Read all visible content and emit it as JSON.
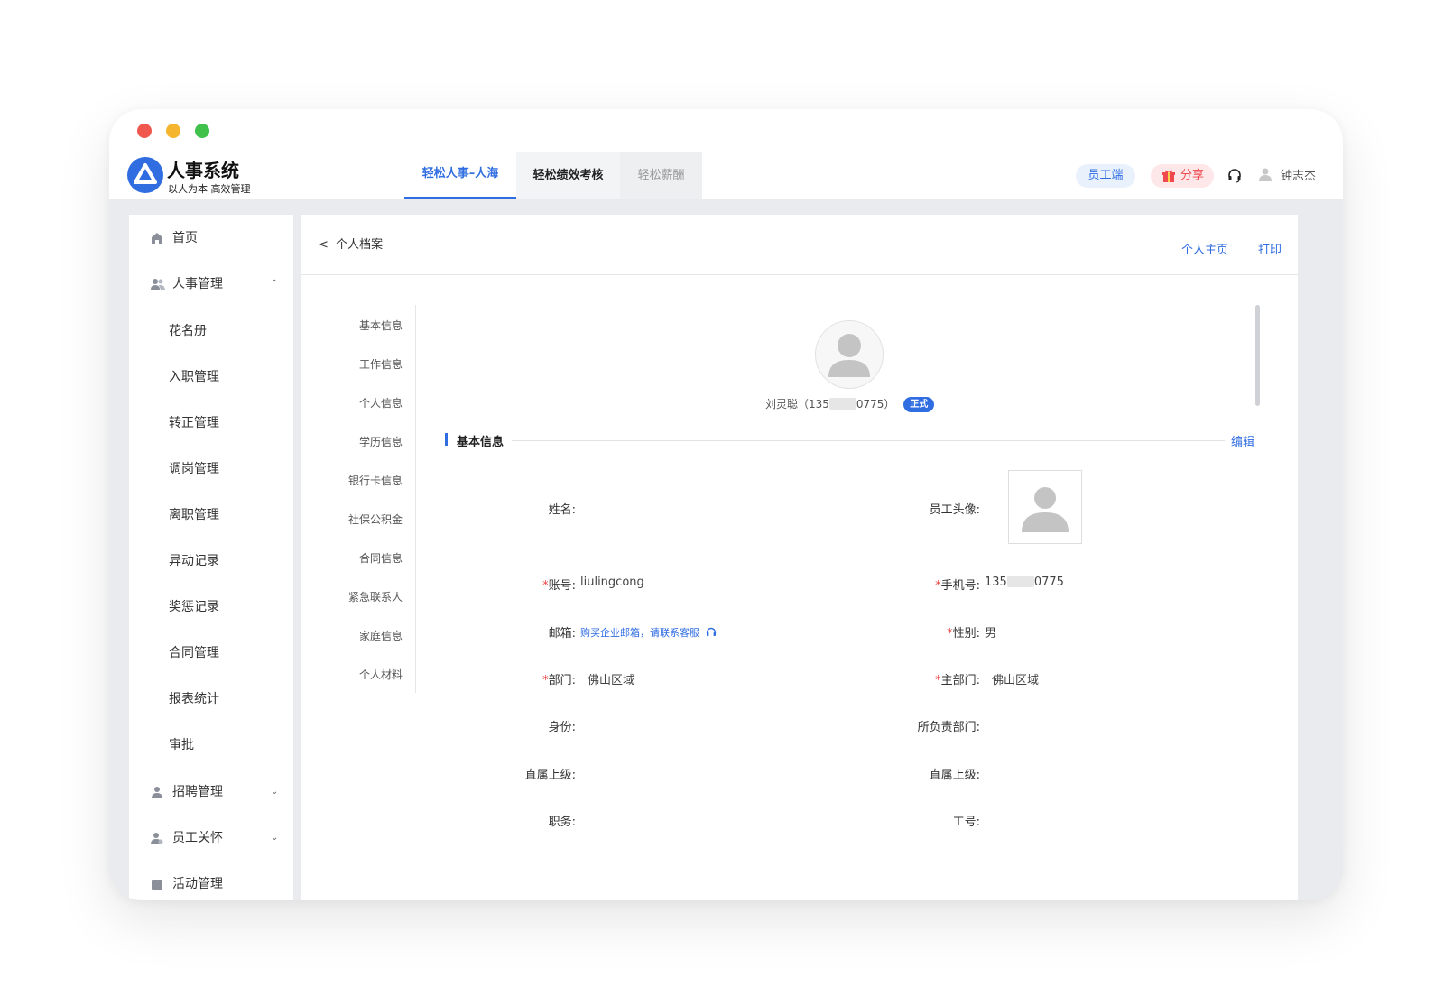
{
  "app": {
    "title": "人事系统",
    "subtitle": "以人为本 高效管理"
  },
  "tabs": [
    {
      "label": "轻松人事–人海",
      "state": "active"
    },
    {
      "label": "轻松绩效考核",
      "state": "normal"
    },
    {
      "label": "轻松薪酬",
      "state": "disabled"
    }
  ],
  "header": {
    "employee_button": "员工端",
    "share_button": "分享",
    "username": "钟志杰"
  },
  "sidebar": {
    "home": "首页",
    "hr_management": "人事管理",
    "hr_sub_items": [
      "花名册",
      "入职管理",
      "转正管理",
      "调岗管理",
      "离职管理",
      "异动记录",
      "奖惩记录",
      "合同管理",
      "报表统计",
      "审批"
    ],
    "recruitment": "招聘管理",
    "employee_care": "员工关怀",
    "activity": "活动管理"
  },
  "page": {
    "back_label": "个人档案",
    "home_link": "个人主页",
    "print_link": "打印"
  },
  "anchors": [
    "基本信息",
    "工作信息",
    "个人信息",
    "学历信息",
    "银行卡信息",
    "社保公积金",
    "合同信息",
    "紧急联系人",
    "家庭信息",
    "个人材料"
  ],
  "profile": {
    "name_phone_prefix": "刘灵聪（135",
    "name_phone_suffix": "0775）",
    "status_badge": "正式"
  },
  "section": {
    "title": "基本信息",
    "edit_label": "编辑"
  },
  "fields": {
    "name_label": "姓名:",
    "photo_label": "员工头像:",
    "account_label": "账号:",
    "account_value": "liulingcong",
    "mobile_label": "手机号:",
    "mobile_prefix": "135",
    "mobile_suffix": "0775",
    "email_label": "邮箱:",
    "email_value": "购买企业邮箱，请联系客服",
    "gender_label": "性别:",
    "gender_value": "男",
    "dept_label": "部门:",
    "dept_value": "佛山区域",
    "main_dept_label": "主部门:",
    "main_dept_value": "佛山区域",
    "identity_label": "身份:",
    "responsible_dept_label": "所负责部门:",
    "direct_superior_label": "直属上级:",
    "direct_superior_label_2": "直属上级:",
    "position_label": "职务:",
    "employee_no_label": "工号:",
    "required_mark": "*"
  },
  "colors": {
    "accent": "#2f6de1",
    "required": "#e94545",
    "share": "#f0484f"
  }
}
